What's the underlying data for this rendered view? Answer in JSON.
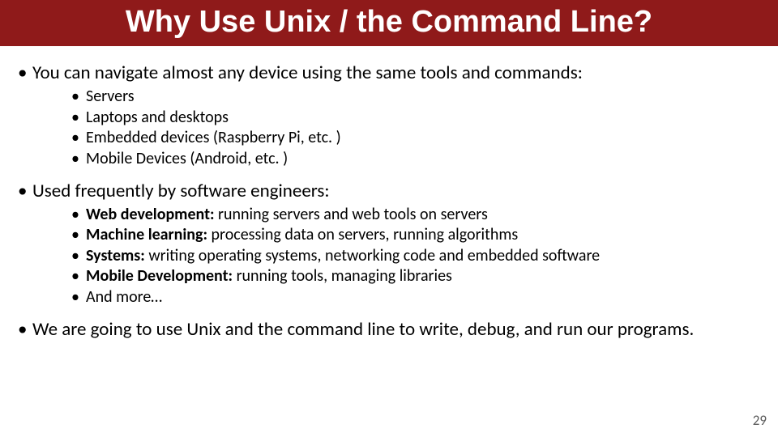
{
  "title": "Why Use Unix / the Command Line?",
  "bullets": {
    "b1": "You can navigate almost any device using the same tools and commands:",
    "b1_sub": {
      "s1": "Servers",
      "s2": "Laptops and desktops",
      "s3": "Embedded devices (Raspberry Pi, etc. )",
      "s4": "Mobile Devices (Android, etc. )"
    },
    "b2": "Used frequently by software engineers:",
    "b2_sub": {
      "s1_bold": "Web development:",
      "s1_rest": " running servers and web tools on servers",
      "s2_bold": "Machine learning:",
      "s2_rest": " processing data on servers, running algorithms",
      "s3_bold": "Systems:",
      "s3_rest": " writing operating systems, networking code and embedded software",
      "s4_bold": "Mobile Development:",
      "s4_rest": " running tools, managing libraries",
      "s5": "And more…"
    },
    "b3": "We are going to use Unix and the command line to write, debug, and run our programs."
  },
  "page_number": "29"
}
